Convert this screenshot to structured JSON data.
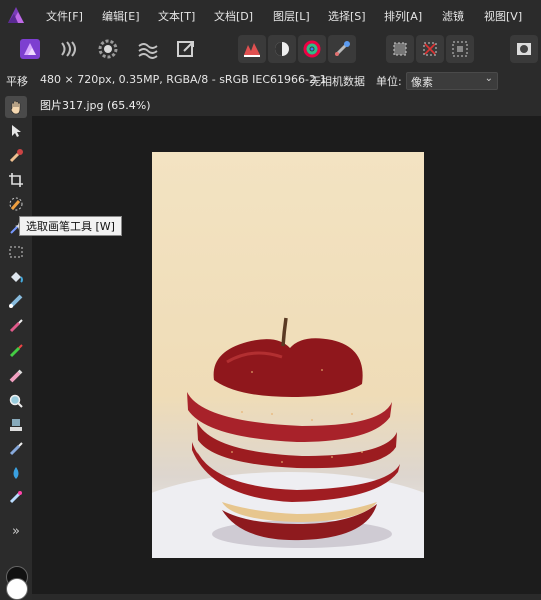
{
  "menu": {
    "items": [
      "文件[F]",
      "编辑[E]",
      "文本[T]",
      "文档[D]",
      "图层[L]",
      "选择[S]",
      "排列[A]",
      "滤镜",
      "视图[V]"
    ]
  },
  "toolbar": {
    "icons": [
      "photo-persona-icon",
      "liquify-persona-icon",
      "develop-persona-icon",
      "tone-mapping-persona-icon",
      "export-persona-icon",
      "auto-levels-icon",
      "auto-contrast-icon",
      "auto-colors-icon",
      "auto-white-balance-icon",
      "selection-mode-icon",
      "deselect-icon",
      "invert-selection-icon",
      "quick-mask-icon"
    ]
  },
  "context": {
    "tool_name": "平移",
    "doc_info": "480 × 720px, 0.35MP, RGBA/8 - sRGB IEC61966-2.1",
    "camera": "无相机数据",
    "unit_label": "单位:",
    "unit_value": "像素"
  },
  "document": {
    "tab_title": "图片317.jpg (65.4%)"
  },
  "tooltip": {
    "text": "选取画笔工具 [W]"
  },
  "tools": [
    "hand-tool-icon",
    "move-tool-icon",
    "color-picker-icon",
    "crop-icon",
    "selection-brush-icon",
    "flood-select-icon",
    "rectangular-marquee-icon",
    "flood-fill-icon",
    "gradient-icon",
    "paint-brush-icon",
    "color-replacement-icon",
    "erase-brush-icon",
    "zoom-icon",
    "clone-brush-icon",
    "healing-brush-icon",
    "blur-brush-icon",
    "retouch-brush-icon",
    "more-tools-icon"
  ],
  "more_tools_label": "»",
  "colors": {
    "accent": "#9b4dd6",
    "primary_color": "#111111",
    "secondary_color": "#ffffff"
  }
}
